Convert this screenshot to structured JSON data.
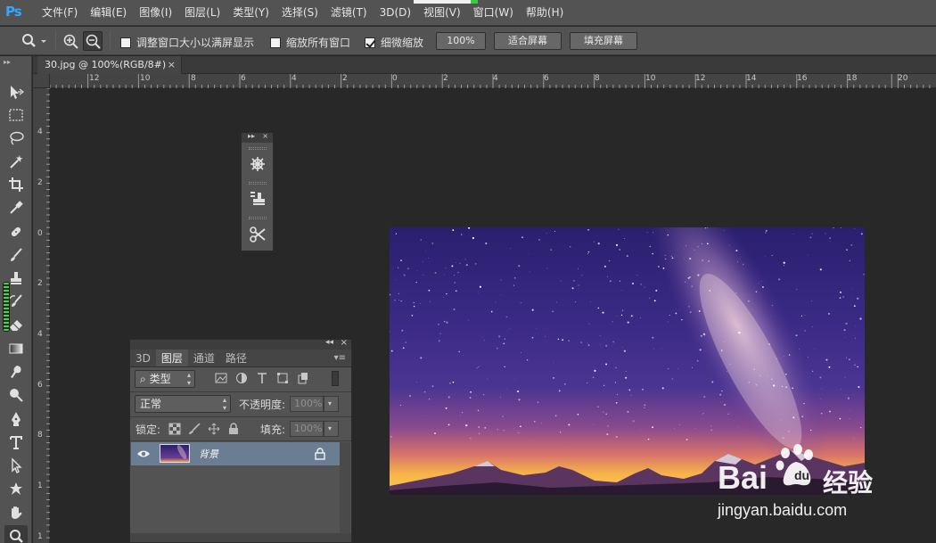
{
  "app": {
    "logo": "Ps",
    "menus": [
      "文件(F)",
      "编辑(E)",
      "图像(I)",
      "图层(L)",
      "类型(Y)",
      "选择(S)",
      "滤镜(T)",
      "3D(D)",
      "视图(V)",
      "窗口(W)",
      "帮助(H)"
    ]
  },
  "options_bar": {
    "tool_icon": "zoom-icon",
    "zoom_in_icon": "zoom-in-icon",
    "zoom_out_icon": "zoom-out-icon",
    "checkbox_resize": {
      "label": "调整窗口大小以满屏显示",
      "checked": false
    },
    "checkbox_zoom_all": {
      "label": "缩放所有窗口",
      "checked": false
    },
    "checkbox_scrubby": {
      "label": "细微缩放",
      "checked": true
    },
    "btn_100": "100%",
    "btn_fit": "适合屏幕",
    "btn_fill": "填充屏幕"
  },
  "document": {
    "tab_title": "30.jpg @ 100%(RGB/8#)",
    "tab_close": "×"
  },
  "rulers": {
    "horizontal": [
      "12",
      "10",
      "8",
      "6",
      "4",
      "2",
      "0",
      "2",
      "4",
      "6",
      "8",
      "10",
      "12",
      "14",
      "16",
      "18",
      "20"
    ],
    "vertical": [
      "4",
      "2",
      "0",
      "2",
      "4",
      "6",
      "8",
      "1",
      "1"
    ]
  },
  "layers_panel": {
    "tabs": [
      "3D",
      "图层",
      "通道",
      "路径"
    ],
    "active_tab": "图层",
    "filter_kind": "类型",
    "blend_mode": "正常",
    "opacity_label": "不透明度:",
    "opacity_value": "100%",
    "lock_label": "锁定:",
    "fill_label": "填充:",
    "fill_value": "100%",
    "layer_name": "背景",
    "layer_visible": true,
    "layer_locked": true
  },
  "watermark": {
    "brand": "Bai",
    "brand_cn": "经验",
    "url": "jingyan.baidu.com"
  },
  "colors": {
    "ui_bg": "#535353",
    "canvas_bg": "#282828",
    "layer_selected": "#6b7d92",
    "ps_blue": "#31a8ff"
  }
}
